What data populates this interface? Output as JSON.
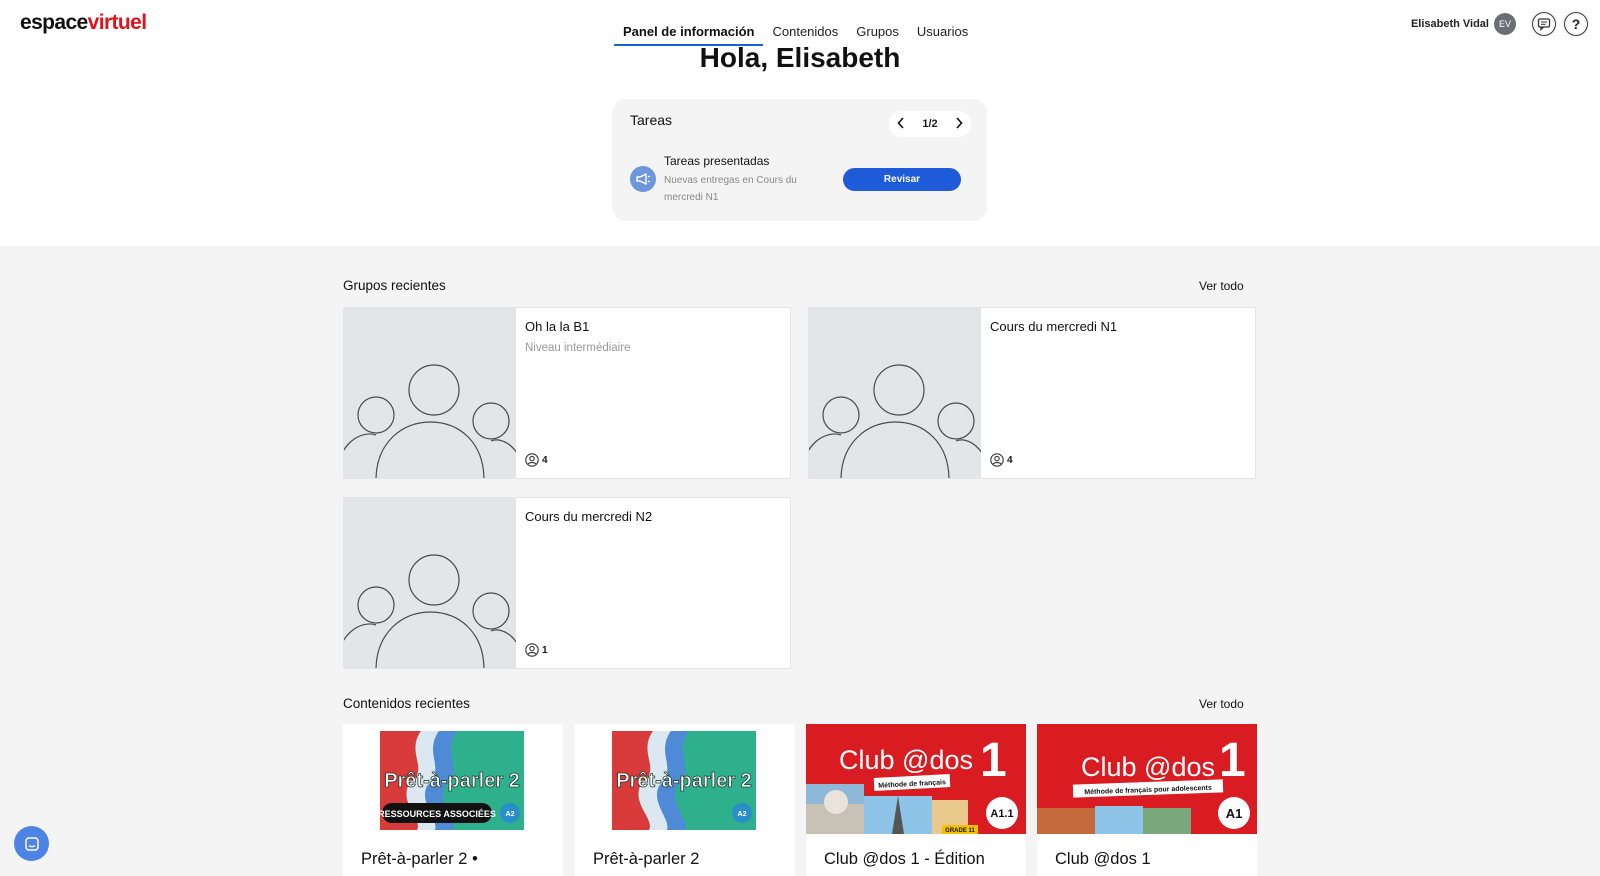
{
  "app": {
    "logo_part1": "espace",
    "logo_part2": "virtuel"
  },
  "nav": {
    "items": [
      {
        "label": "Panel de información",
        "active": true
      },
      {
        "label": "Contenidos",
        "active": false
      },
      {
        "label": "Grupos",
        "active": false
      },
      {
        "label": "Usuarios",
        "active": false
      }
    ]
  },
  "user": {
    "name": "Elisabeth Vidal",
    "initials": "EV",
    "help_glyph": "?"
  },
  "greeting": "Hola, Elisabeth",
  "tasks": {
    "title": "Tareas",
    "page": "1/2",
    "item": {
      "icon": "megaphone-icon",
      "name": "Tareas presentadas",
      "description": "Nuevas entregas en Cours du mercredi N1",
      "action": "Revisar"
    }
  },
  "recent_groups": {
    "title": "Grupos recientes",
    "see_all": "Ver todo",
    "items": [
      {
        "name": "Oh la la B1",
        "level": "Niveau intermédiaire",
        "members": "4"
      },
      {
        "name": "Cours du mercredi N1",
        "level": "",
        "members": "4"
      },
      {
        "name": "Cours du mercredi N2",
        "level": "",
        "members": "1"
      }
    ]
  },
  "recent_contents": {
    "title": "Contenidos recientes",
    "see_all": "Ver todo",
    "items": [
      {
        "title": "Prêt-à-parler 2 •",
        "cover_title": "Prêt-à-parler 2",
        "cover_banner": "RESSOURCES ASSOCIÉES",
        "cover_level": "A2"
      },
      {
        "title": "Prêt-à-parler 2",
        "cover_title": "Prêt-à-parler 2",
        "cover_level": "A2"
      },
      {
        "title": "Club @dos 1 - Édition",
        "cover_title": "Club @dos",
        "cover_number": "1",
        "cover_subtitle": "Méthode de français",
        "cover_level": "A1.1",
        "cover_grade": "GRADE 11"
      },
      {
        "title": "Club @dos 1",
        "cover_title": "Club @dos",
        "cover_number": "1",
        "cover_subtitle": "Méthode de français pour adolescents",
        "cover_level": "A1"
      }
    ]
  },
  "colors": {
    "accent": "#1d5bd8",
    "brand_red": "#e2111b",
    "cover_green": "#2db08b",
    "cover_red": "#d91b22"
  }
}
